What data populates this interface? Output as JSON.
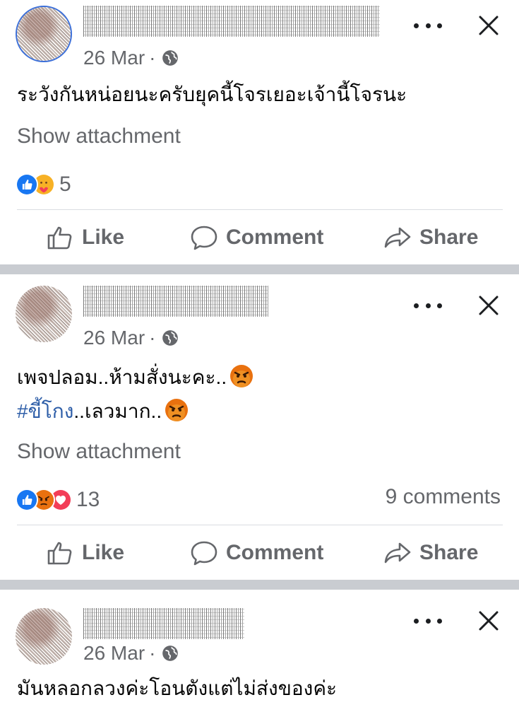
{
  "posts": [
    {
      "date": "26 Mar",
      "separator": "·",
      "text_lines": [
        "ระวังกันหน่อยนะครับยุคนี้โจรเยอะเจ้านี้โจรนะ"
      ],
      "attachment_label": "Show attachment",
      "reaction_icons": [
        "like-icon",
        "care-icon"
      ],
      "reaction_count": "5",
      "comments": ""
    },
    {
      "date": "26 Mar",
      "separator": "·",
      "line1": "เพจปลอม..ห้ามสั่งนะคะ..",
      "line2_hashtag": "#ขี้โกง",
      "line2_rest": "..เลวมาก..",
      "attachment_label": "Show attachment",
      "reaction_icons": [
        "like-icon",
        "angry-icon",
        "love-icon"
      ],
      "reaction_count": "13",
      "comments": "9 comments"
    },
    {
      "date": "26 Mar",
      "separator": "·",
      "text_lines": [
        "มันหลอกลวงค่ะโอนตังแต่ไม่ส่งของค่ะ"
      ]
    }
  ],
  "actions": {
    "like": "Like",
    "comment": "Comment",
    "share": "Share"
  },
  "colors": {
    "link": "#2e5ea8",
    "muted": "#65676b",
    "like_blue": "#1877f2",
    "love_red": "#f33e58",
    "angry_orange": "#e9710f",
    "separator": "#c9ccd1"
  }
}
